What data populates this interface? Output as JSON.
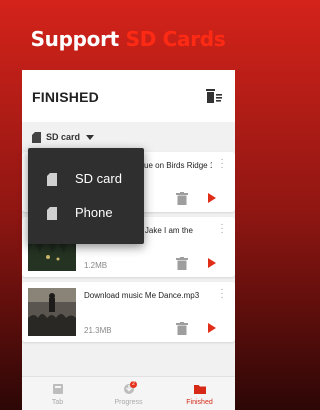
{
  "headline": {
    "part1": "Support ",
    "accent": "SD Cards"
  },
  "appbar": {
    "title": "FINISHED",
    "action_icon": "clear-list-icon"
  },
  "storage_filter": {
    "selected": "SD card",
    "icon": "sd-card-icon"
  },
  "storage_menu": {
    "items": [
      {
        "label": "SD card",
        "icon": "sd-card-icon"
      },
      {
        "label": "Phone",
        "icon": "sd-card-icon"
      }
    ]
  },
  "downloads": [
    {
      "title": "Sky Hunter Rescue on Birds Ridge 1080p",
      "size": "",
      "thumbnail": "snow-scene"
    },
    {
      "title": "Download music Jake I am the",
      "size": "1.2MB",
      "thumbnail": "night-forest"
    },
    {
      "title": "Download music Me Dance.mp3",
      "size": "21.3MB",
      "thumbnail": "concert-crowd"
    }
  ],
  "bottom_nav": [
    {
      "label": "Tab",
      "icon": "tab-icon",
      "active": false
    },
    {
      "label": "Progress",
      "icon": "progress-icon",
      "active": false,
      "badge": "2"
    },
    {
      "label": "Finished",
      "icon": "folder-icon",
      "active": true
    }
  ],
  "colors": {
    "accent": "#e02d18",
    "background_top": "#d4231a",
    "background_bottom": "#2c0706"
  }
}
